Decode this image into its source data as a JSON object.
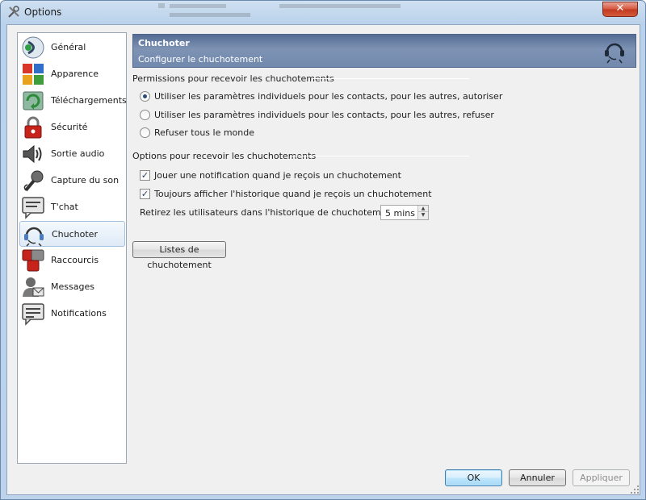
{
  "window": {
    "title": "Options"
  },
  "sidebar": {
    "items": [
      {
        "label": "Général",
        "icon": "speaker-general-icon"
      },
      {
        "label": "Apparence",
        "icon": "color-tiles-icon"
      },
      {
        "label": "Téléchargements",
        "icon": "download-icon"
      },
      {
        "label": "Sécurité",
        "icon": "padlock-icon"
      },
      {
        "label": "Sortie audio",
        "icon": "speaker-icon"
      },
      {
        "label": "Capture du son",
        "icon": "microphone-icon"
      },
      {
        "label": "T'chat",
        "icon": "chat-bubble-icon"
      },
      {
        "label": "Chuchoter",
        "icon": "headset-icon",
        "selected": true
      },
      {
        "label": "Raccourcis",
        "icon": "shortcut-keys-icon"
      },
      {
        "label": "Messages",
        "icon": "messages-icon"
      },
      {
        "label": "Notifications",
        "icon": "notification-bubble-icon"
      }
    ]
  },
  "banner": {
    "title": "Chuchoter",
    "subtitle": "Configurer le chuchotement"
  },
  "permissions": {
    "title": "Permissions pour recevoir les chuchotements",
    "options": [
      {
        "label": "Utiliser les paramètres individuels pour les contacts, pour les autres, autoriser",
        "checked": true
      },
      {
        "label": "Utiliser les paramètres individuels pour les contacts, pour les autres, refuser",
        "checked": false
      },
      {
        "label": "Refuser tous le monde",
        "checked": false
      }
    ]
  },
  "receive_options": {
    "title": "Options pour recevoir les chuchotements",
    "checkboxes": [
      {
        "label": "Jouer une notification quand je reçois un chuchotement",
        "checked": true
      },
      {
        "label": "Toujours afficher l'historique quand je reçois un chuchotement",
        "checked": true
      }
    ],
    "retire_label": "Retirez les utilisateurs dans l'historique de chuchotement après",
    "retire_value": "5 mins"
  },
  "whisper_lists_button": "Listes de chuchotement",
  "footer": {
    "ok": "OK",
    "cancel": "Annuler",
    "apply": "Appliquer"
  },
  "colors": {
    "banner": "#6f86aa",
    "selection": "#dfeaf6",
    "close": "#c9452b"
  }
}
